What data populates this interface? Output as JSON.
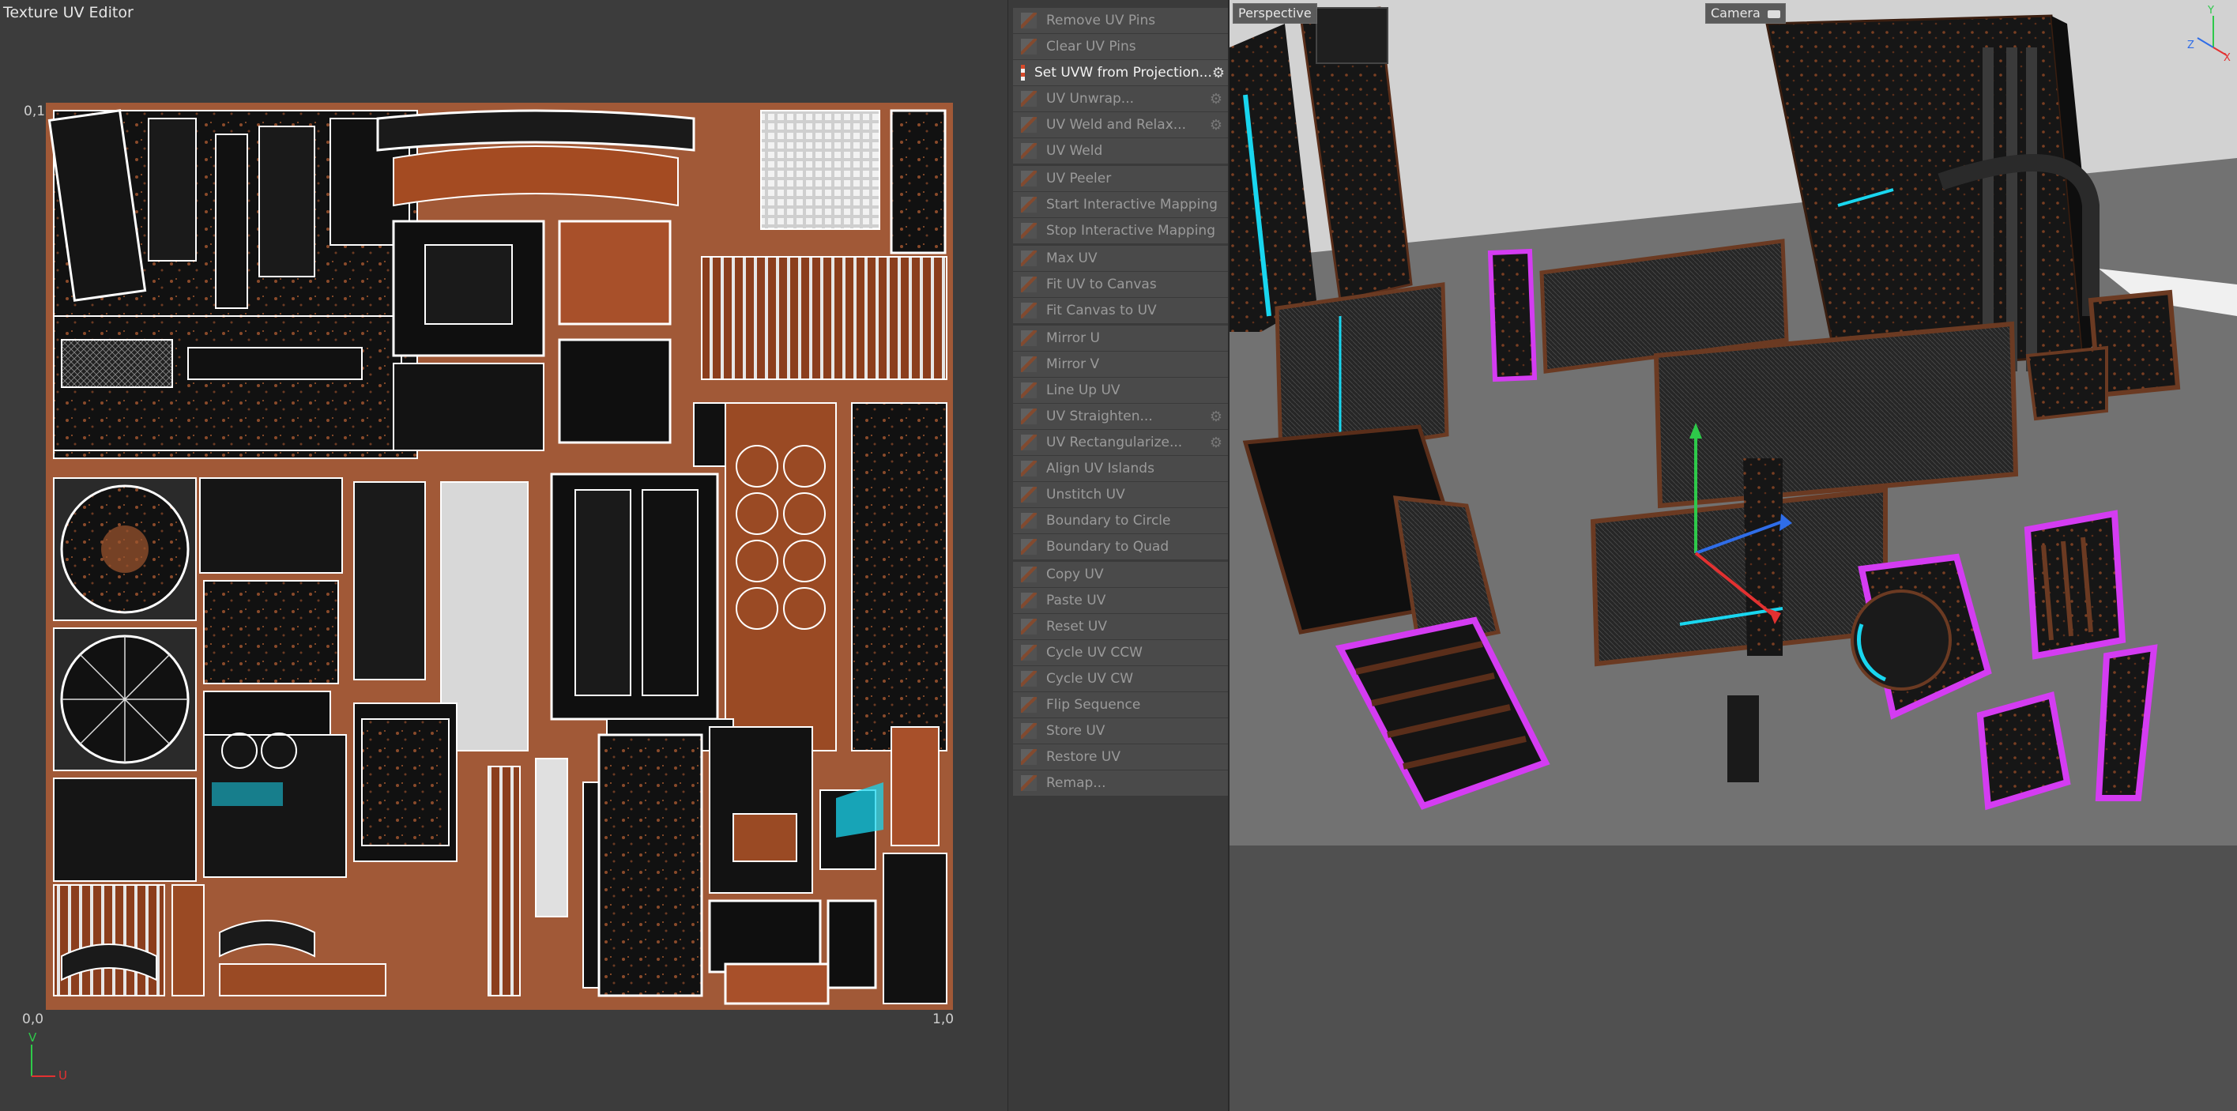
{
  "uv_editor": {
    "title": "Texture UV Editor",
    "corner_top_left": "0,1",
    "corner_bottom_left": "0,0",
    "corner_bottom_right": "1,0",
    "axis_v": "V",
    "axis_u": "U"
  },
  "menu": {
    "items": [
      {
        "label": "Remove UV Pins",
        "icon": "pin-icon",
        "has_gear": false
      },
      {
        "label": "Clear UV Pins",
        "icon": "pin-clear-icon",
        "has_gear": false
      },
      {
        "label": "Set UVW from Projection...",
        "icon": "checker-icon",
        "has_gear": true,
        "active": true
      },
      {
        "label": "UV Unwrap...",
        "icon": "unwrap-icon",
        "has_gear": true
      },
      {
        "label": "UV Weld and Relax...",
        "icon": "weld-relax-icon",
        "has_gear": true
      },
      {
        "label": "UV Weld",
        "icon": "weld-icon",
        "has_gear": false
      },
      {
        "label": "UV Peeler",
        "icon": "peeler-icon",
        "has_gear": false
      },
      {
        "label": "Start Interactive Mapping",
        "icon": "interactive-start-icon",
        "has_gear": false
      },
      {
        "label": "Stop Interactive Mapping",
        "icon": "interactive-stop-icon",
        "has_gear": false
      },
      {
        "label": "Max UV",
        "icon": "max-uv-icon",
        "has_gear": false
      },
      {
        "label": "Fit UV to Canvas",
        "icon": "fit-uv-icon",
        "has_gear": false
      },
      {
        "label": "Fit Canvas to UV",
        "icon": "fit-canvas-icon",
        "has_gear": false
      },
      {
        "label": "Mirror U",
        "icon": "mirror-u-icon",
        "has_gear": false
      },
      {
        "label": "Mirror V",
        "icon": "mirror-v-icon",
        "has_gear": false
      },
      {
        "label": "Line Up UV",
        "icon": "line-up-icon",
        "has_gear": false
      },
      {
        "label": "UV Straighten...",
        "icon": "straighten-icon",
        "has_gear": true
      },
      {
        "label": "UV Rectangularize...",
        "icon": "rectangularize-icon",
        "has_gear": true
      },
      {
        "label": "Align UV Islands",
        "icon": "align-islands-icon",
        "has_gear": false
      },
      {
        "label": "Unstitch UV",
        "icon": "unstitch-icon",
        "has_gear": false
      },
      {
        "label": "Boundary to Circle",
        "icon": "boundary-circle-icon",
        "has_gear": false
      },
      {
        "label": "Boundary to Quad",
        "icon": "boundary-quad-icon",
        "has_gear": false
      },
      {
        "label": "Copy UV",
        "icon": "copy-icon",
        "has_gear": false
      },
      {
        "label": "Paste UV",
        "icon": "paste-icon",
        "has_gear": false
      },
      {
        "label": "Reset UV",
        "icon": "reset-icon",
        "has_gear": false
      },
      {
        "label": "Cycle UV CCW",
        "icon": "cycle-ccw-icon",
        "has_gear": false
      },
      {
        "label": "Cycle UV CW",
        "icon": "cycle-cw-icon",
        "has_gear": false
      },
      {
        "label": "Flip Sequence",
        "icon": "flip-sequence-icon",
        "has_gear": false
      },
      {
        "label": "Store UV",
        "icon": "store-icon",
        "has_gear": false
      },
      {
        "label": "Restore UV",
        "icon": "restore-icon",
        "has_gear": false
      },
      {
        "label": "Remap...",
        "icon": "remap-icon",
        "has_gear": false
      }
    ]
  },
  "viewport": {
    "view_name": "Perspective",
    "camera_label": "Camera",
    "camera_icon": "camera-icon",
    "axis_labels": {
      "y": "Y",
      "z": "Z",
      "x": "X"
    }
  },
  "colors": {
    "panel_bg": "#3c3c3c",
    "rust": "#b8592b",
    "selection_glow": "#d43cf2",
    "accent_cyan": "#19d6ef",
    "axis_y": "#2ec94a",
    "axis_x": "#e33131",
    "axis_z": "#2f6de8"
  }
}
